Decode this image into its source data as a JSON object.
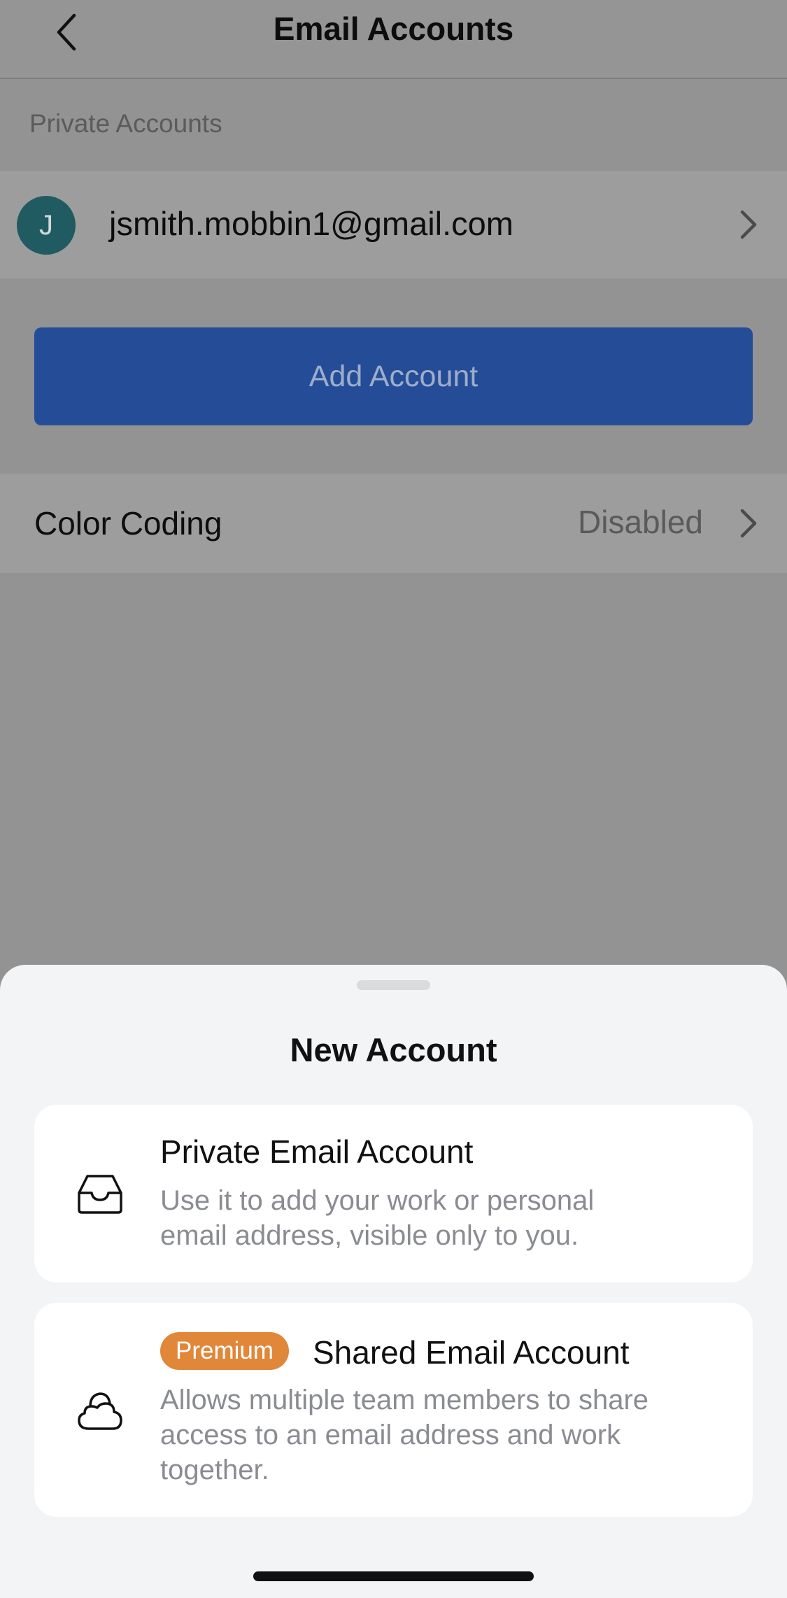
{
  "header": {
    "title": "Email Accounts",
    "back_icon": "chevron-left-icon"
  },
  "private_accounts": {
    "section_label": "Private Accounts",
    "accounts": [
      {
        "avatar_initial": "J",
        "email": "jsmith.mobbin1@gmail.com",
        "avatar_color": "#215b62"
      }
    ]
  },
  "add_account": {
    "label": "Add Account",
    "color": "#254d97"
  },
  "color_coding": {
    "label": "Color Coding",
    "value": "Disabled"
  },
  "sheet": {
    "title": "New Account",
    "options": [
      {
        "icon": "inbox-tray-icon",
        "title": "Private Email Account",
        "description_line1": "Use it to add your work or personal",
        "description_line2": "email address, visible only to you."
      },
      {
        "icon": "team-cloud-icon",
        "badge": "Premium",
        "badge_color": "#e0873a",
        "title": "Shared Email Account",
        "description_line1": "Allows multiple team members to share",
        "description_line2": "access to an email address and work",
        "description_line3": "together."
      }
    ]
  }
}
